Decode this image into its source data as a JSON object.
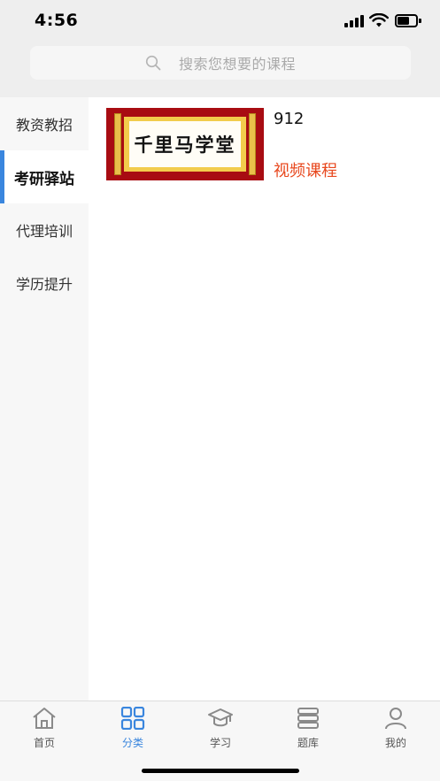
{
  "status_bar": {
    "time": "4:56"
  },
  "search": {
    "placeholder": "搜索您想要的课程"
  },
  "sidebar": {
    "items": [
      {
        "label": "教资教招",
        "active": false
      },
      {
        "label": "考研驿站",
        "active": true
      },
      {
        "label": "代理培训",
        "active": false
      },
      {
        "label": "学历提升",
        "active": false
      }
    ]
  },
  "courses": [
    {
      "thumb_text": "千里马学堂",
      "title": "912",
      "type": "视频课程"
    }
  ],
  "tabbar": {
    "items": [
      {
        "label": "首页",
        "icon": "home-icon"
      },
      {
        "label": "分类",
        "icon": "grid-icon",
        "active": true
      },
      {
        "label": "学习",
        "icon": "graduation-cap-icon"
      },
      {
        "label": "题库",
        "icon": "book-stack-icon"
      },
      {
        "label": "我的",
        "icon": "user-icon"
      }
    ]
  },
  "colors": {
    "accent": "#3a86de",
    "course_type": "#e8481e",
    "thumb_red": "#a80c12",
    "thumb_gold": "#f2cc4c"
  }
}
